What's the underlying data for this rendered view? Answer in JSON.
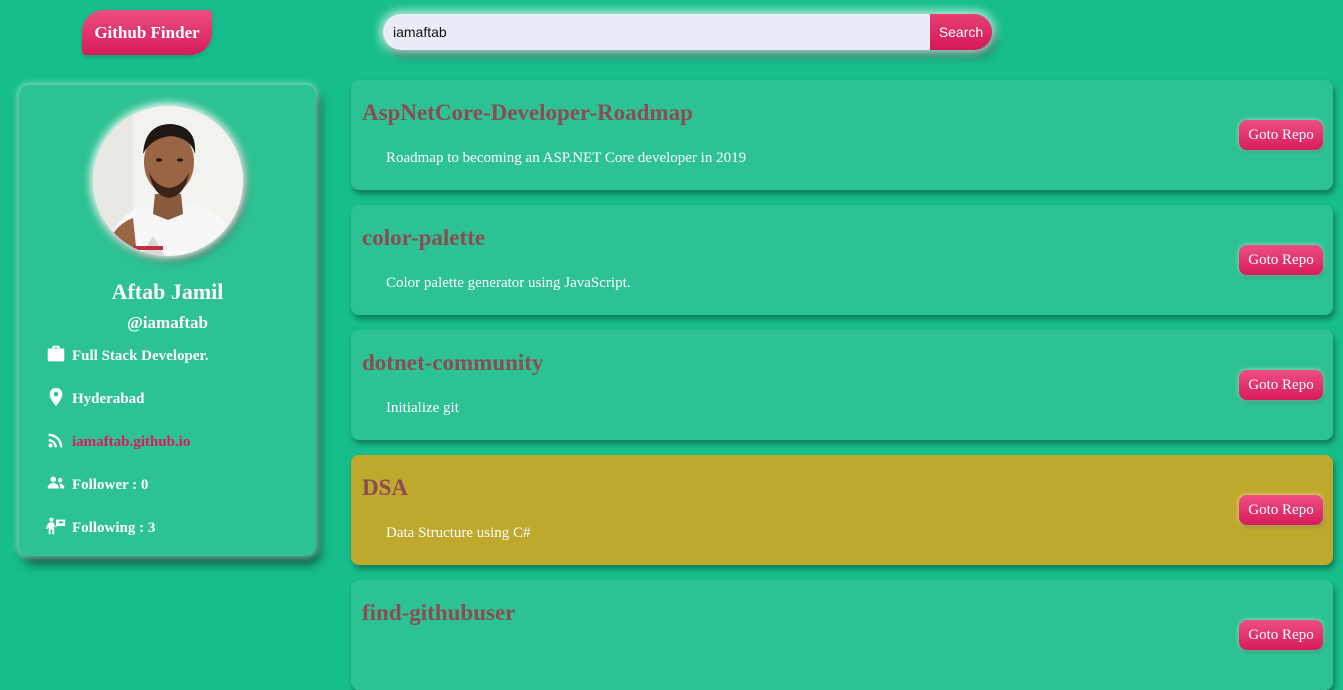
{
  "header": {
    "brand": "Github Finder",
    "search": {
      "value": "iamaftab",
      "button_label": "Search"
    }
  },
  "profile": {
    "name": "Aftab Jamil",
    "handle": "@iamaftab",
    "job": "Full Stack Developer.",
    "location": "Hyderabad",
    "website": "iamaftab.github.io",
    "followers": "Follower : 0",
    "following": "Following : 3"
  },
  "repos": [
    {
      "name": "AspNetCore-Developer-Roadmap",
      "description": "Roadmap to becoming an ASP.NET Core developer in 2019",
      "button_label": "Goto Repo"
    },
    {
      "name": "color-palette",
      "description": "Color palette generator using JavaScript.",
      "button_label": "Goto Repo"
    },
    {
      "name": "dotnet-community",
      "description": "Initialize git",
      "button_label": "Goto Repo"
    },
    {
      "name": "DSA",
      "description": "Data Structure using C#",
      "button_label": "Goto Repo"
    },
    {
      "name": "find-githubuser",
      "description": "",
      "button_label": "Goto Repo"
    }
  ],
  "colors": {
    "background": "#17bd8b",
    "card": "#2dc293",
    "card_highlight": "#bfa92d",
    "accent": "#d81b5a",
    "repo_title": "#8c4b55"
  }
}
